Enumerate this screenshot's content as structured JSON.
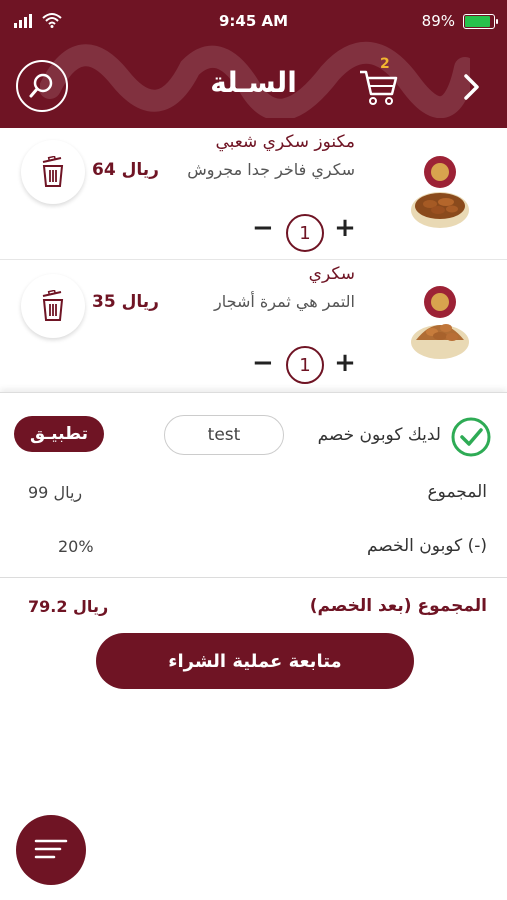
{
  "status_bar": {
    "time": "9:45 AM",
    "battery_percent": "89%",
    "battery_level": 0.89
  },
  "header": {
    "title": "السـلة",
    "cart_count": "2"
  },
  "cart_items": [
    {
      "name": "مكنوز سكري شعبي",
      "description": "سكري فاخر جدا مجروش",
      "price": "64 ريال",
      "quantity": "1"
    },
    {
      "name": "سكري",
      "description": "التمر هي ثمرة أشجار",
      "price": "35 ريال",
      "quantity": "1"
    }
  ],
  "controls": {
    "minus": "−",
    "plus": "+"
  },
  "coupon": {
    "label": "لديك كوبون خصم",
    "code": "test",
    "apply_label": "تطبيـق"
  },
  "summary": {
    "total_label": "المجموع",
    "total_value": "99 ريال",
    "discount_label": "كوبون الخصم (-)",
    "discount_value": "20%",
    "final_label": "المجموع (بعد الخصم)",
    "final_value": "79.2 ريال"
  },
  "checkout_label": "متابعة عملية الشراء",
  "colors": {
    "brand": "#6f1424",
    "cart_badge": "#f2b630",
    "check": "#2eab55",
    "battery": "#27c24c"
  },
  "icons": [
    "signal-icon",
    "wifi-icon",
    "battery-icon",
    "search-icon",
    "cart-icon",
    "chevron-right-icon",
    "trash-icon",
    "check-circle-icon",
    "menu-icon"
  ]
}
